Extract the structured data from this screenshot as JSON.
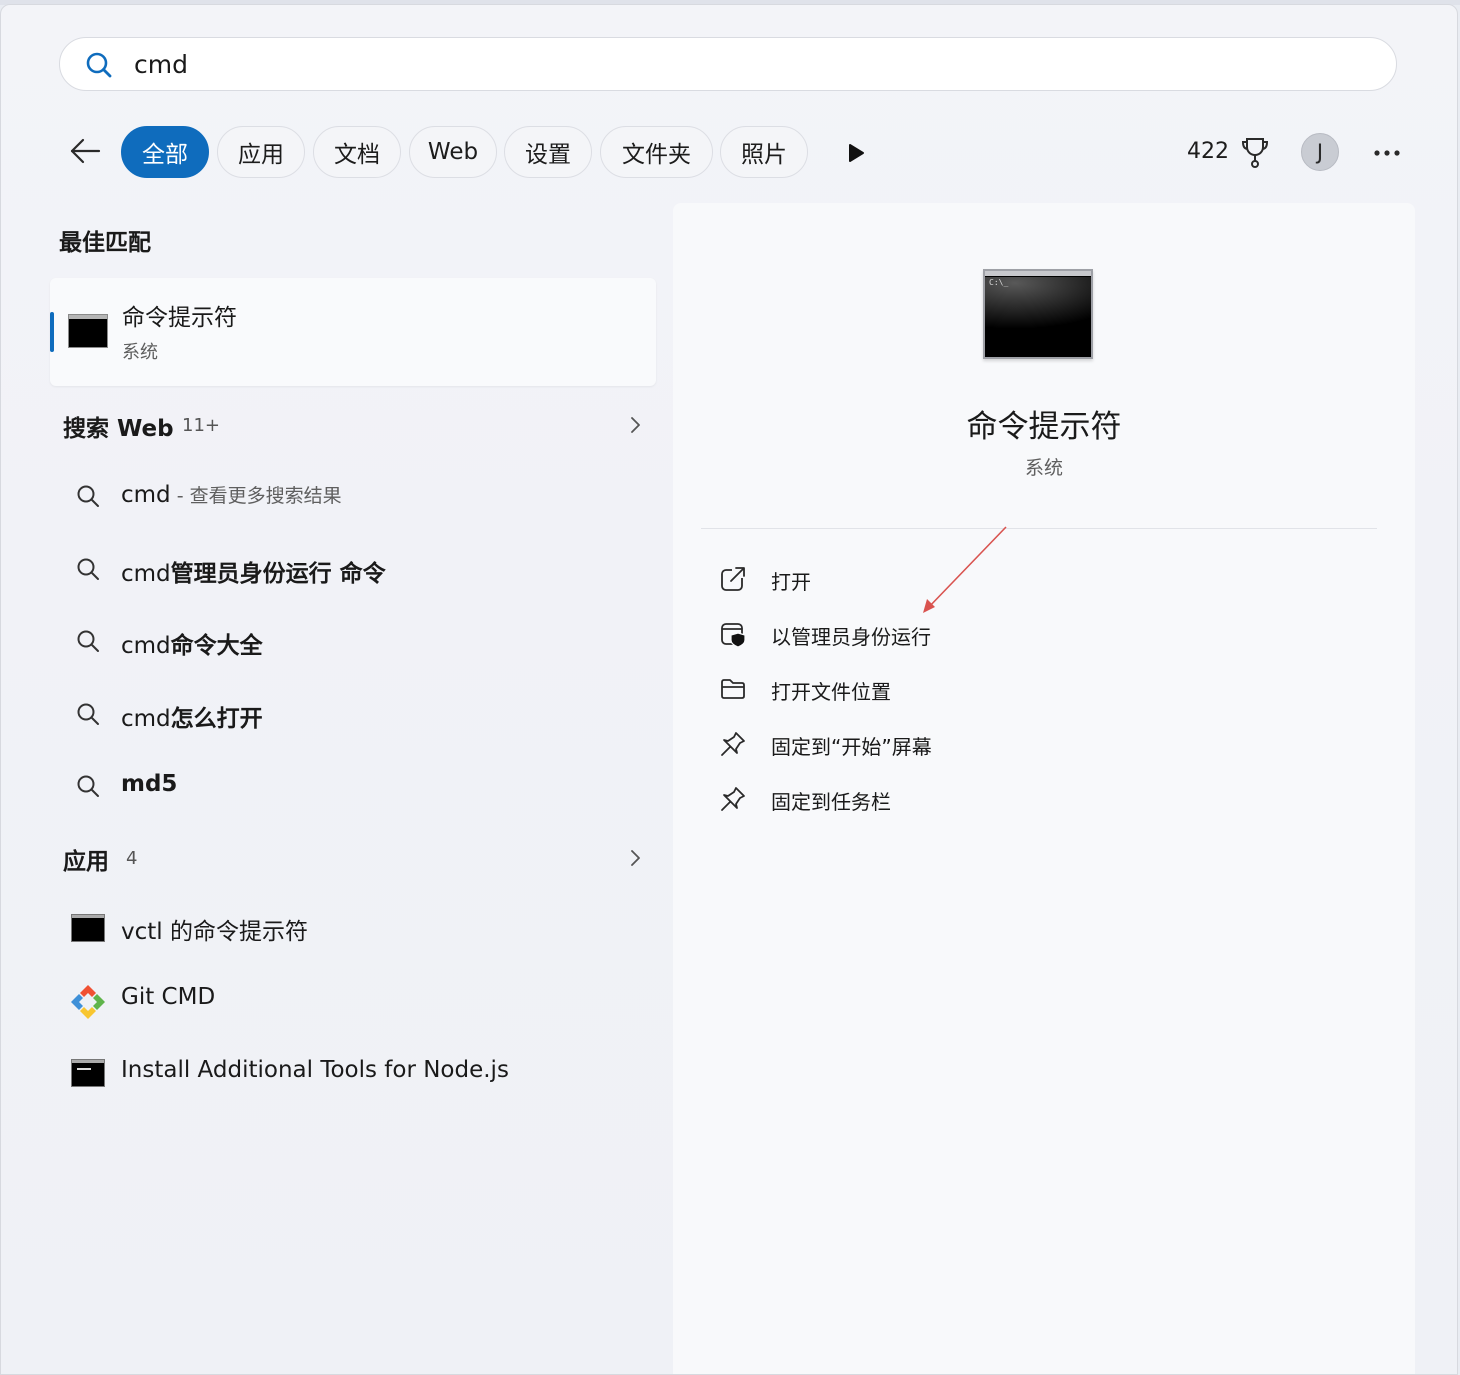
{
  "search": {
    "value": "cmd",
    "placeholder": ""
  },
  "filters": [
    {
      "label": "全部",
      "active": true
    },
    {
      "label": "应用",
      "active": false
    },
    {
      "label": "文档",
      "active": false
    },
    {
      "label": "Web",
      "active": false
    },
    {
      "label": "设置",
      "active": false
    },
    {
      "label": "文件夹",
      "active": false
    },
    {
      "label": "照片",
      "active": false
    }
  ],
  "header": {
    "points": "422",
    "avatar_initial": "J",
    "more": "···"
  },
  "best_match": {
    "heading": "最佳匹配",
    "title": "命令提示符",
    "subtitle": "系统"
  },
  "web": {
    "heading": "搜索 Web",
    "count": "11+",
    "items": [
      {
        "prefix": "cmd",
        "bold": "",
        "hint": " - 查看更多搜索结果"
      },
      {
        "prefix": "cmd",
        "bold": "管理员身份运行 命令",
        "hint": ""
      },
      {
        "prefix": "cmd",
        "bold": "命令大全",
        "hint": ""
      },
      {
        "prefix": "cmd",
        "bold": "怎么打开",
        "hint": ""
      },
      {
        "prefix": "",
        "bold": "md5",
        "hint": ""
      }
    ]
  },
  "apps": {
    "heading": "应用",
    "count": "4",
    "items": [
      {
        "label": "vctl 的命令提示符"
      },
      {
        "label": "Git CMD"
      },
      {
        "label": "Install Additional Tools for Node.js"
      }
    ]
  },
  "detail": {
    "title": "命令提示符",
    "subtitle": "系统",
    "icon_text": "C:\\_",
    "actions": [
      {
        "label": "打开",
        "icon": "open-external-icon"
      },
      {
        "label": "以管理员身份运行",
        "icon": "admin-shield-icon"
      },
      {
        "label": "打开文件位置",
        "icon": "folder-icon"
      },
      {
        "label": "固定到“开始”屏幕",
        "icon": "pin-icon"
      },
      {
        "label": "固定到任务栏",
        "icon": "pin-icon"
      }
    ]
  },
  "colors": {
    "accent": "#0f6cbd",
    "annotation_arrow": "#d9534f"
  }
}
